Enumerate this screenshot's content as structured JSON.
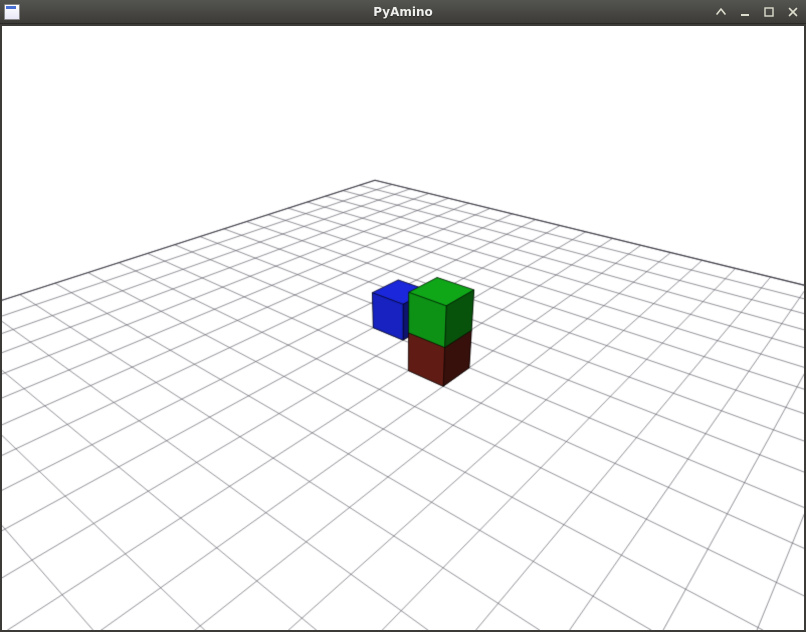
{
  "window": {
    "title": "PyAmino"
  },
  "scene": {
    "grid": {
      "size": 20,
      "color": "#555560"
    },
    "objects": [
      {
        "name": "blue-cube",
        "color": "#1a26d6",
        "pos": [
          -1,
          0,
          0
        ]
      },
      {
        "name": "red-cube",
        "color": "#6b1f16",
        "pos": [
          1,
          -1,
          0
        ]
      },
      {
        "name": "green-cube",
        "color": "#0fa318",
        "pos": [
          1,
          -1,
          1
        ]
      }
    ],
    "camera": {
      "elevation": 30,
      "azimuth": -40,
      "distance": 16
    }
  }
}
